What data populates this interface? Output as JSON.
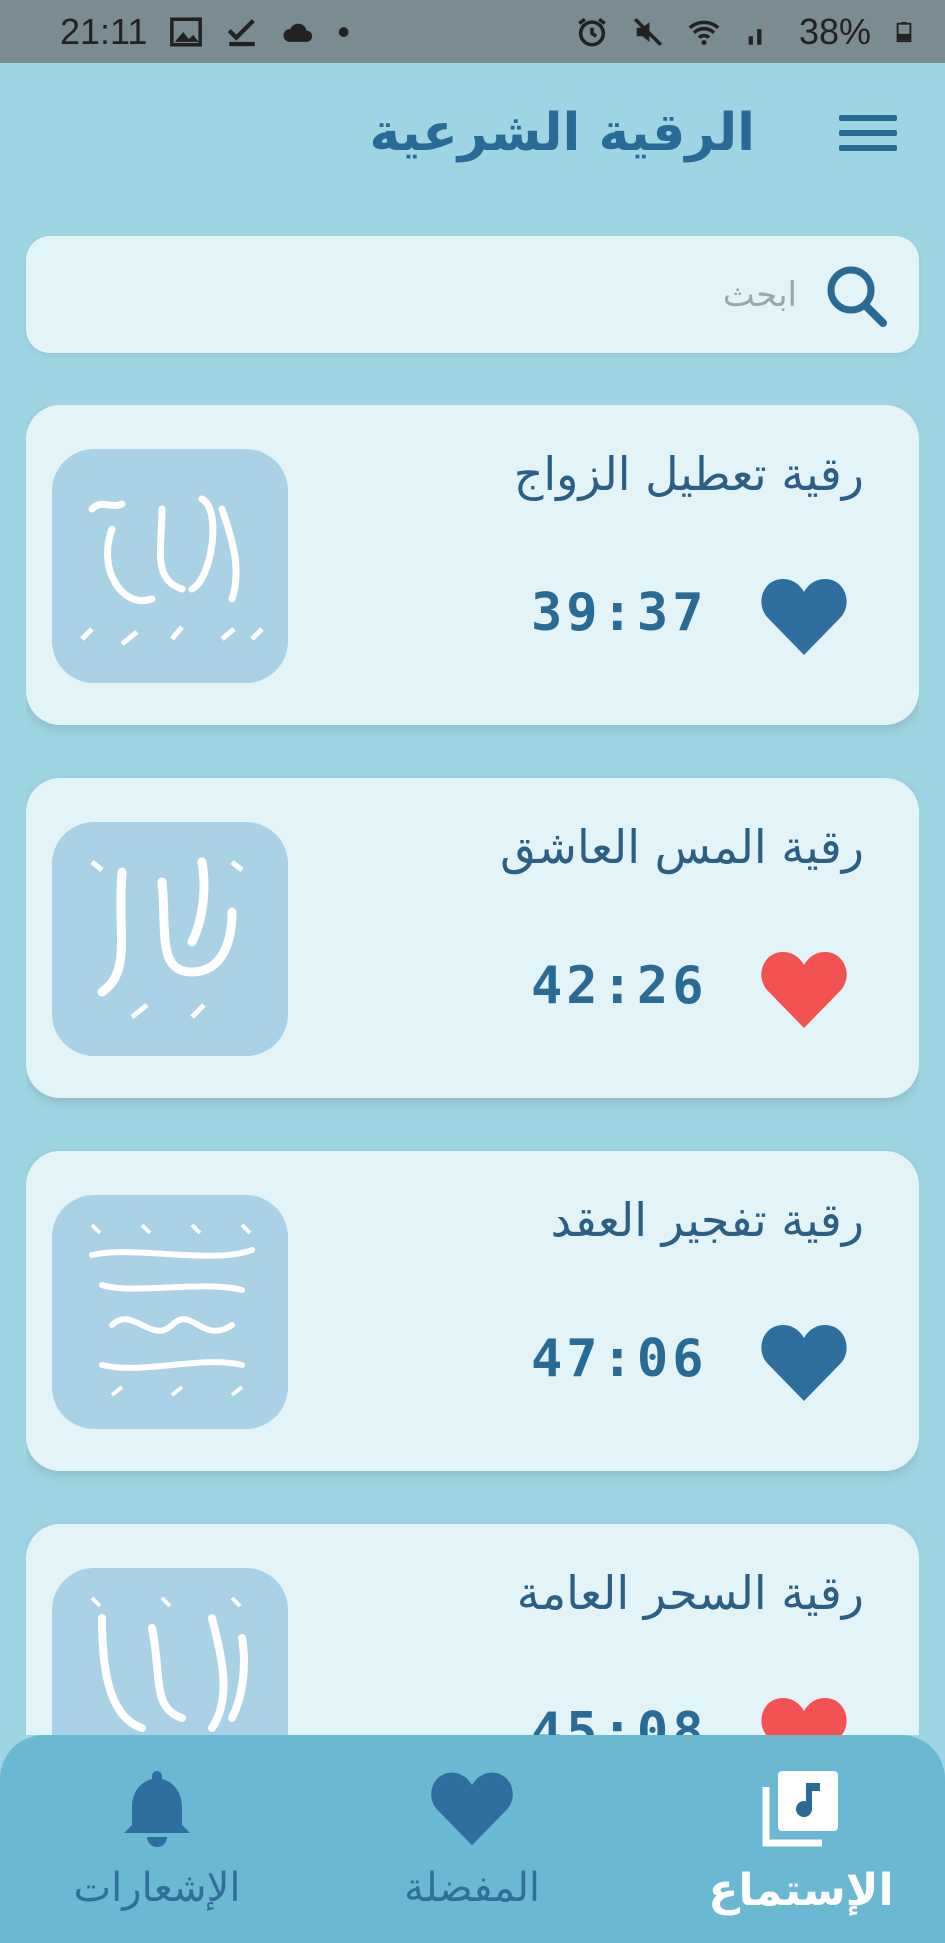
{
  "status_bar": {
    "time": "21:11",
    "battery": "38%",
    "dot": "•",
    "left_icons": [
      "image-icon",
      "check-icon",
      "cloud-icon"
    ],
    "right_icons": [
      "alarm-icon",
      "mute-icon",
      "wifi-icon",
      "signal-icon",
      "battery-icon"
    ]
  },
  "header": {
    "title": "الرقية الشرعية",
    "menu_icon": "hamburger-menu-icon"
  },
  "search": {
    "placeholder": "ابحث",
    "icon": "search-icon"
  },
  "items": [
    {
      "title": "رقية تعطيل الزواج",
      "duration": "39:37",
      "favorite": false,
      "thumbnail_text": "الزواج"
    },
    {
      "title": "رقية المس العاشق",
      "duration": "42:26",
      "favorite": true,
      "thumbnail_text": "المس"
    },
    {
      "title": "رقية تفجير العقد",
      "duration": "47:06",
      "favorite": false,
      "thumbnail_text": "تفجير العقد"
    },
    {
      "title": "رقية السحر العامة",
      "duration": "45:08",
      "favorite": true,
      "thumbnail_text": "العامة"
    }
  ],
  "colors": {
    "background": "#9fd4e2",
    "card": "#e3f4f9",
    "primary": "#2a6b96",
    "heart_inactive": "#2f6f9f",
    "heart_active": "#f25252",
    "nav": "#6bb8d3"
  },
  "bottom_nav": [
    {
      "label": "الإستماع",
      "icon": "music-library-icon",
      "active": true
    },
    {
      "label": "المفضلة",
      "icon": "heart-icon",
      "active": false
    },
    {
      "label": "الإشعارات",
      "icon": "bell-icon",
      "active": false
    }
  ]
}
